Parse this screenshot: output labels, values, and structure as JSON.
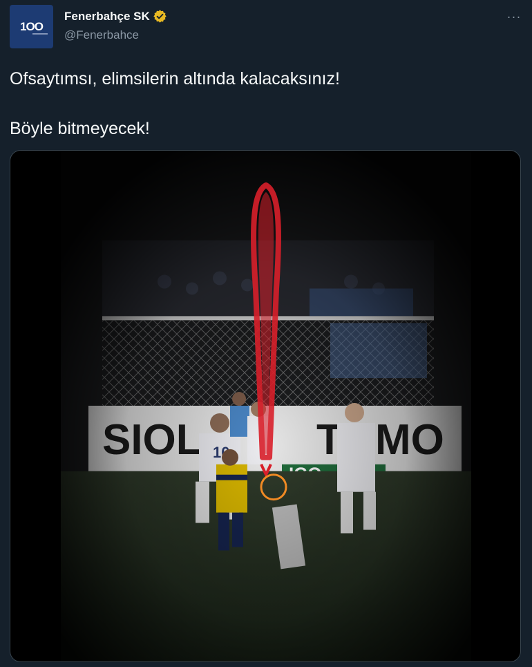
{
  "tweet": {
    "avatar_text": "1OO",
    "display_name": "Fenerbahçe SK",
    "handle": "@Fenerbahce",
    "more_label": "···",
    "text_line1": "Ofsaytımsı, elimsilerin altında kalacaksınız!",
    "text_line2": "Böyle bitmeyecek!",
    "verified_color": "#e8b923",
    "avatar_color": "#1d3b73"
  },
  "media": {
    "overlay_signs": [
      "SIOL",
      "TOMO",
      "10",
      "IGO"
    ]
  },
  "colors": {
    "background": "#15202b",
    "text": "#f7f9f9",
    "muted": "#8b98a5",
    "highlight_red": "#d81f2a",
    "highlight_orange": "#f08a24"
  }
}
